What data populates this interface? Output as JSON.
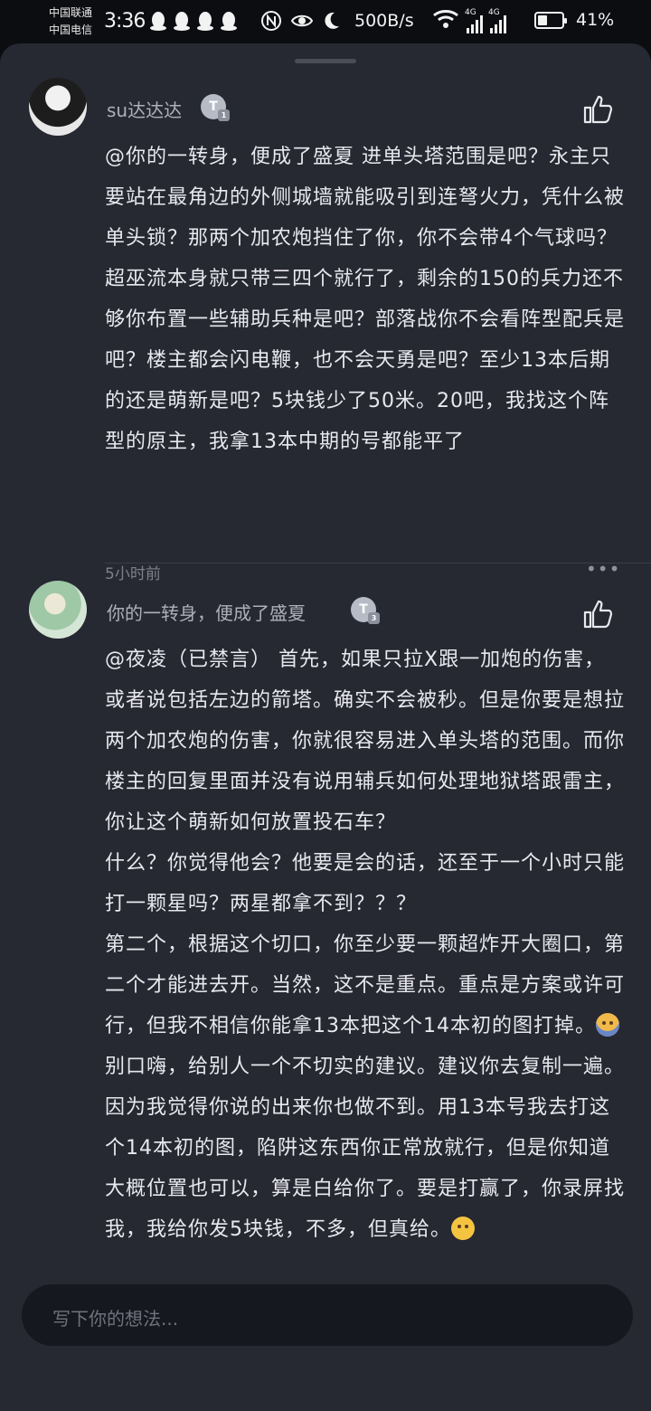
{
  "status_bar": {
    "carrier_1": "中国联通",
    "carrier_2": "中国电信",
    "time": "3:36",
    "network_speed": "500B/s",
    "signal_1_label": "4G",
    "signal_2_label": "4G",
    "battery_text": "41%",
    "battery_level": 0.41,
    "icons_left": [
      "qq-icon",
      "qq-icon",
      "qq-icon",
      "qq-icon"
    ],
    "icons_mid": [
      "nfc-icon",
      "eye-icon",
      "moon-icon"
    ]
  },
  "comments": [
    {
      "username": "su达达达",
      "level_badge": "T",
      "body": "@你的一转身，便成了盛夏 进单头塔范围是吧？永主只要站在最角边的外侧城墙就能吸引到连弩火力，凭什么被单头锁？那两个加农炮挡住了你，你不会带4个气球吗？超巫流本身就只带三四个就行了，剩余的150的兵力还不够你布置一些辅助兵种是吧？部落战你不会看阵型配兵是吧？楼主都会闪电鞭，也不会天勇是吧？至少13本后期的还是萌新是吧？5块钱少了50米。20吧，我找这个阵型的原主，我拿13本中期的号都能平了",
      "timestamp": "5小时前",
      "more_label": "•••"
    },
    {
      "username": "你的一转身，便成了盛夏",
      "level_badge": "T",
      "body_parts": [
        "@夜凌（已禁言） 首先，如果只拉X跟一加炮的伤害，或者说包括左边的箭塔。确实不会被秒。但是你要是想拉两个加农炮的伤害，你就很容易进入单头塔的范围。而你楼主的回复里面并没有说用辅兵如何处理地狱塔跟雷主，你让这个萌新如何放置投石车？\n什么？你觉得他会？他要是会的话，还至于一个小时只能打一颗星吗？两星都拿不到？？？\n第二个，根据这个切口，你至少要一颗超炸开大圈口，第二个才能进去开。当然，这不是重点。重点是方案或许可行，但我不相信你能拿13本把这个14本初的图打掉。",
        "\n别口嗨，给别人一个不切实的建议。建议你去复制一遍。因为我觉得你说的出来你也做不到。用13本号我去打这个14本初的图，陷阱这东西你正常放就行，但是你知道大概位置也可以，算是白给你了。要是打赢了，你录屏找我，我给你发5块钱，不多，但真给。"
      ]
    }
  ],
  "input": {
    "placeholder": "写下你的想法..."
  }
}
